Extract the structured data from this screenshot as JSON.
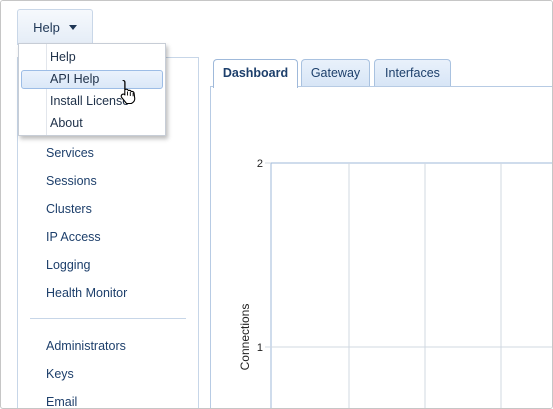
{
  "header": {
    "help_menu": {
      "label": "Help",
      "icon": "chevron-down-icon"
    }
  },
  "dropdown": {
    "items": [
      {
        "label": "Help"
      },
      {
        "label": "API Help",
        "active": true
      },
      {
        "label": "Install License"
      },
      {
        "label": "About"
      }
    ]
  },
  "sidebar": {
    "items": [
      {
        "label": "Services"
      },
      {
        "label": "Sessions"
      },
      {
        "label": "Clusters"
      },
      {
        "label": "IP Access"
      },
      {
        "label": "Logging"
      },
      {
        "label": "Health Monitor"
      }
    ],
    "items2": [
      {
        "label": "Administrators"
      },
      {
        "label": "Keys"
      },
      {
        "label": "Email"
      }
    ]
  },
  "tabs": [
    {
      "label": "Dashboard",
      "active": true
    },
    {
      "label": "Gateway"
    },
    {
      "label": "Interfaces"
    }
  ],
  "chart_data": {
    "type": "line",
    "title": "",
    "xlabel": "",
    "ylabel": "Connections",
    "ylim_visible": [
      1,
      2
    ],
    "y_ticks": [
      "2",
      "1"
    ],
    "grid": true,
    "series": []
  },
  "colors": {
    "link": "#1d3f6b",
    "tab_border": "#a9c2e0",
    "grid": "#d0d8e2",
    "active_menu_bg": "#dbe8f8"
  }
}
